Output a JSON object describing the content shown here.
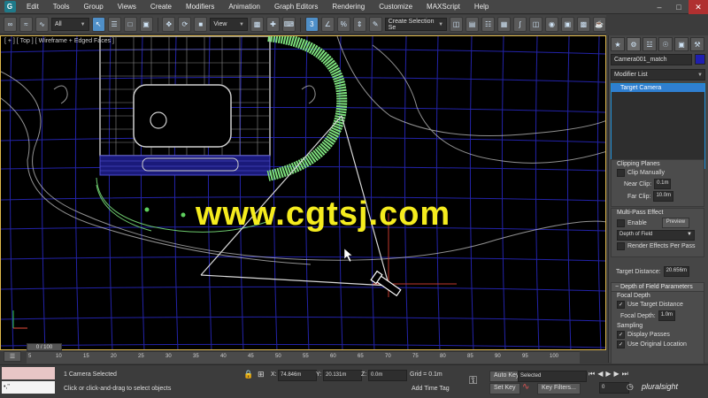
{
  "menu": {
    "logo": "G",
    "items": [
      "Edit",
      "Tools",
      "Group",
      "Views",
      "Create",
      "Modifiers",
      "Animation",
      "Graph Editors",
      "Rendering",
      "Customize",
      "MAXScript",
      "Help"
    ]
  },
  "toolbar": {
    "filter": "All",
    "coord_system": "View",
    "selection_set": "Create Selection Se"
  },
  "viewport": {
    "label": "[ + ] [ Top ] [ Wireframe + Edged Faces ]"
  },
  "watermark": "www.cgtsj.com",
  "command_panel": {
    "object_name": "Camera001_match",
    "object_color": "#1f1fb0",
    "modifier_list": "Modifier List",
    "stack_item": "Target Camera",
    "clipping": {
      "title": "Clipping Planes",
      "clip_manually": "Clip Manually",
      "near_label": "Near Clip:",
      "near_value": "0.1m",
      "far_label": "Far Clip:",
      "far_value": "10.0m"
    },
    "multipass": {
      "title": "Multi-Pass Effect",
      "enable": "Enable",
      "preview": "Preview",
      "effect": "Depth of Field",
      "render_effects": "Render Effects Per Pass"
    },
    "target_distance_label": "Target Distance:",
    "target_distance_value": "20.656m",
    "dof": {
      "header": "Depth of Field Parameters",
      "focal_depth_title": "Focal Depth",
      "use_target": "Use Target Distance",
      "focal_depth_label": "Focal Depth:",
      "focal_depth_value": "1.0m",
      "sampling_title": "Sampling",
      "display_passes": "Display Passes",
      "use_original": "Use Original Location"
    }
  },
  "timeline": {
    "slider": "0 / 100",
    "ticks": [
      "5",
      "10",
      "15",
      "20",
      "25",
      "30",
      "35",
      "40",
      "45",
      "50",
      "55",
      "60",
      "65",
      "70",
      "75",
      "80",
      "85",
      "90",
      "95",
      "100"
    ]
  },
  "status": {
    "selected": "1 Camera Selected",
    "prompt": "Click or click-and-drag to select objects",
    "x_label": "X:",
    "x_value": "74.846m",
    "y_label": "Y:",
    "y_value": "20.131m",
    "z_label": "Z:",
    "z_value": "0.0m",
    "grid": "Grid = 0.1m",
    "add_time_tag": "Add Time Tag",
    "auto_key": "Auto Key",
    "key_mode": "Selected",
    "set_key": "Set Key",
    "key_filters": "Key Filters...",
    "frame": "0",
    "brand": "pluralsight"
  }
}
